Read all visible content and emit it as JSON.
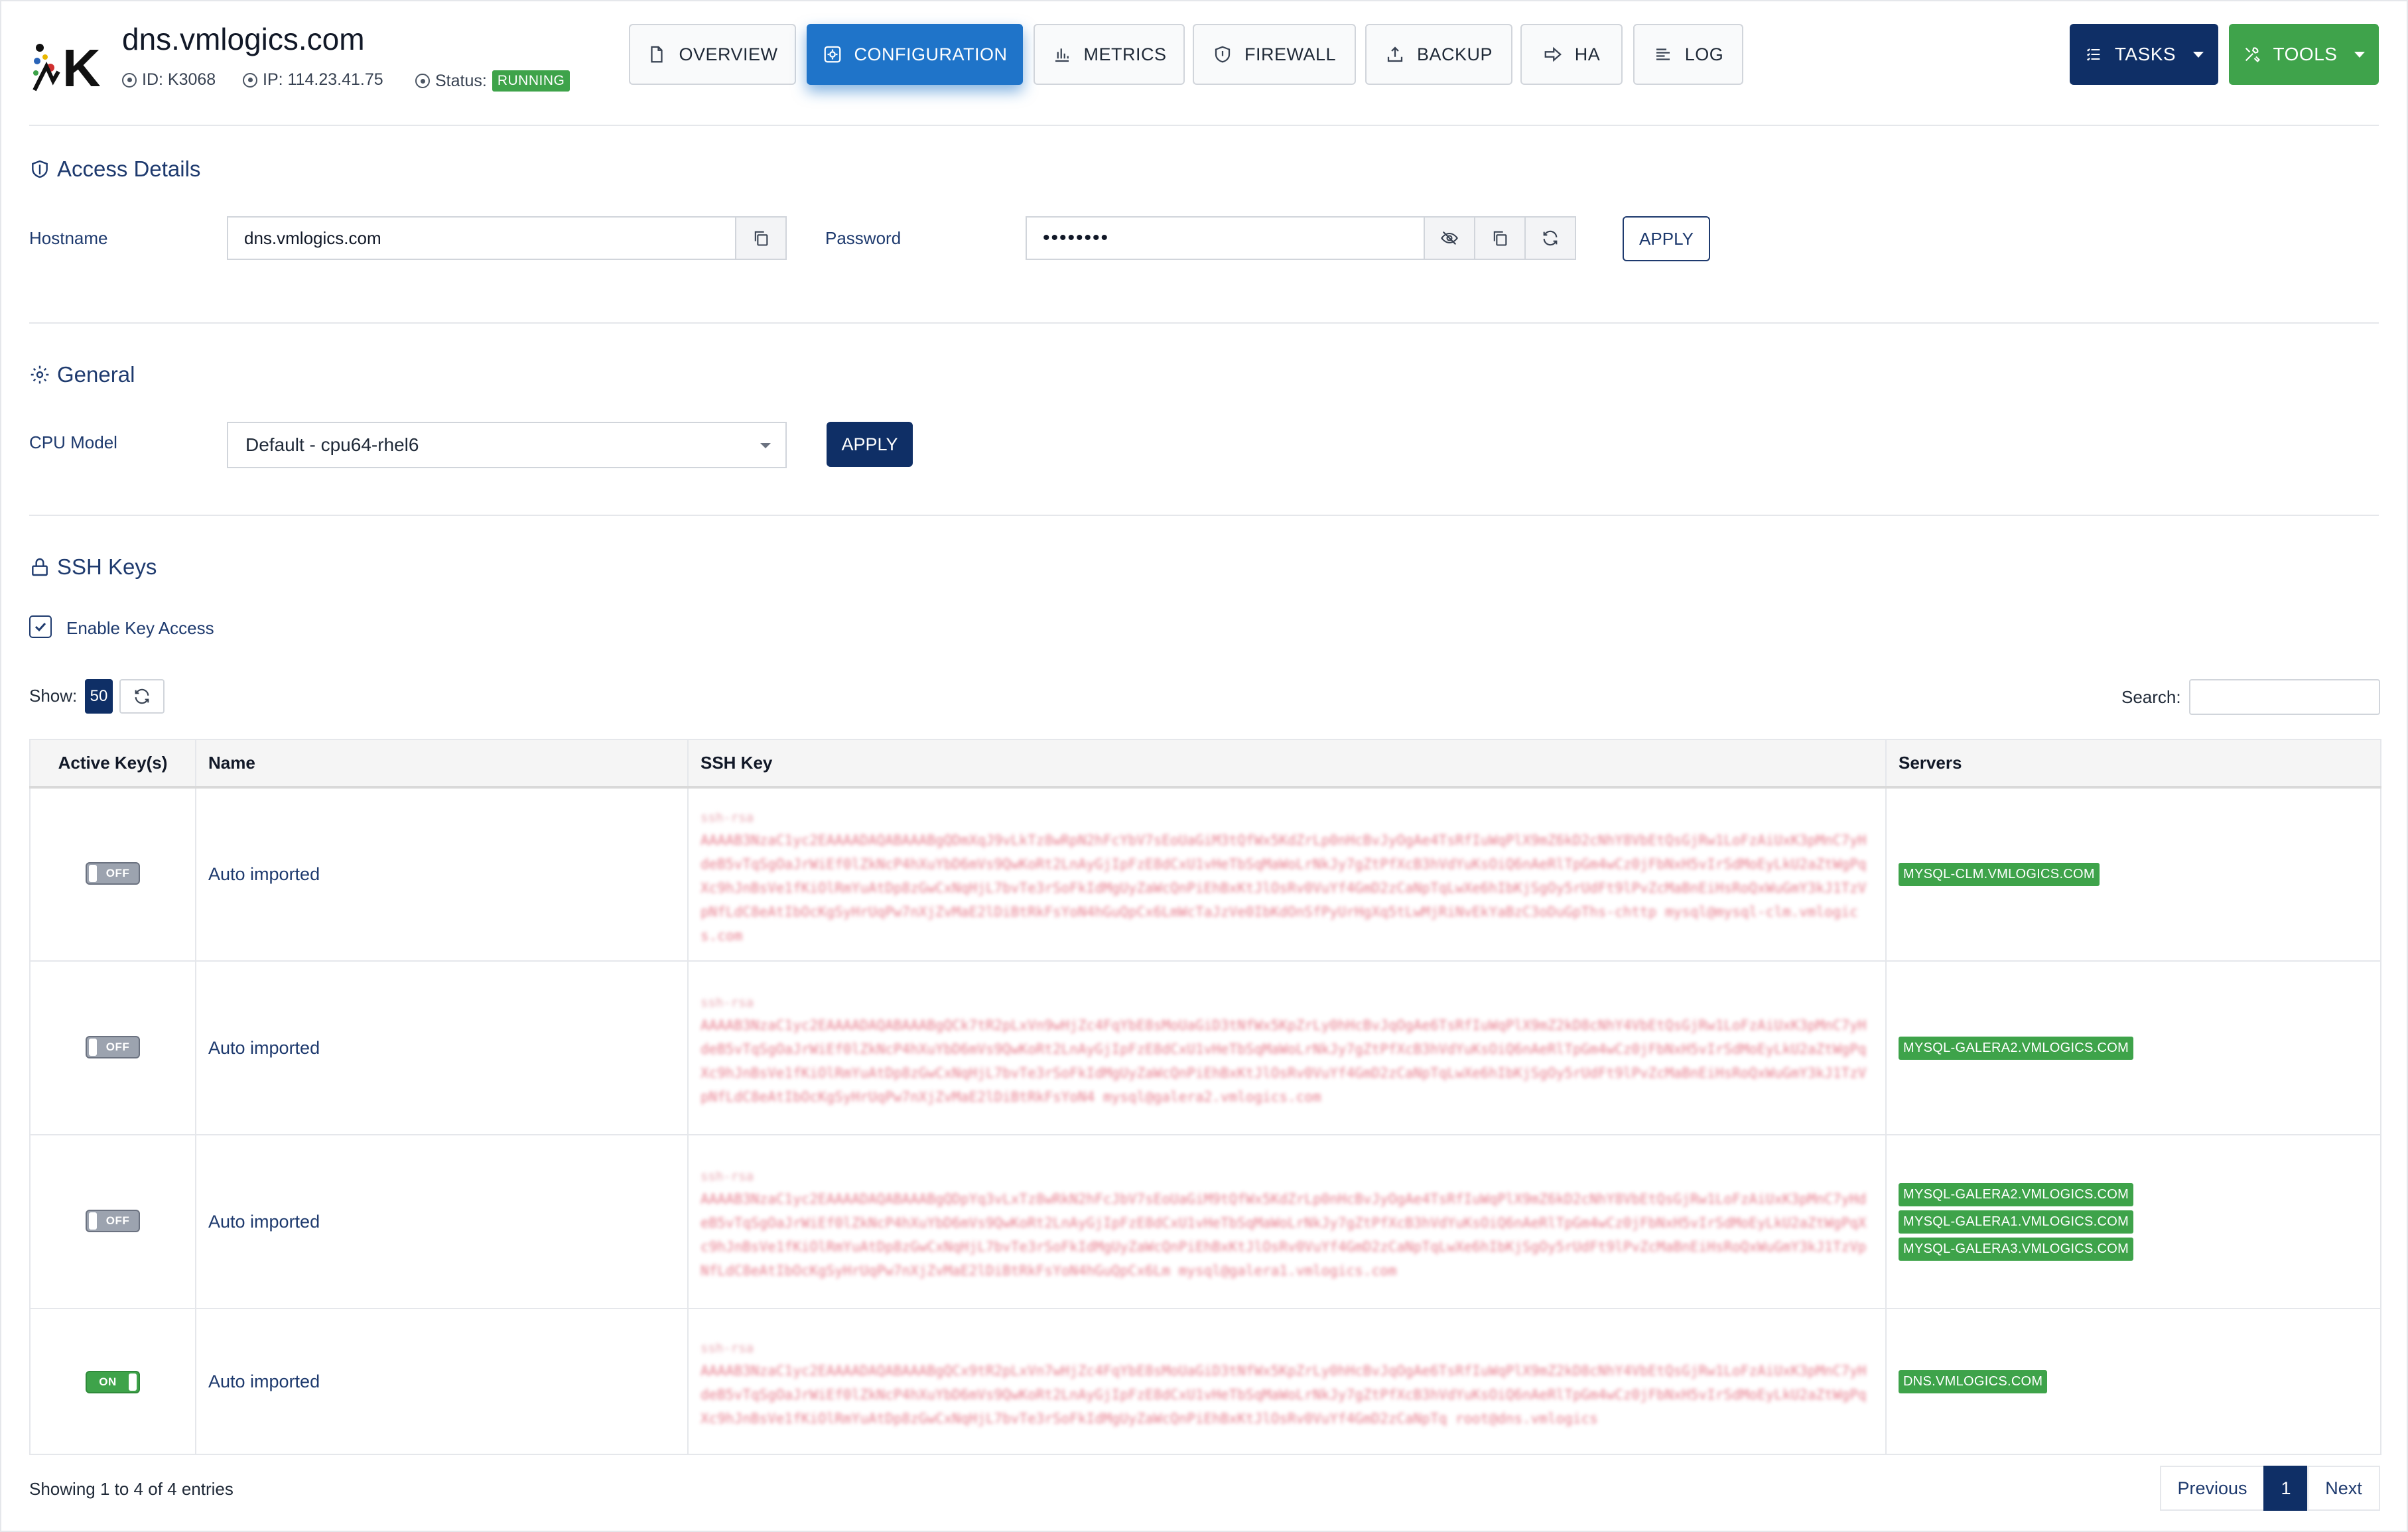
{
  "header": {
    "title": "dns.vmlogics.com",
    "id_label": "ID: K3068",
    "ip_label": "IP: 114.23.41.75",
    "status_label": "Status:",
    "status_value": "RUNNING",
    "status_color": "#3ea34a"
  },
  "nav_tabs": [
    {
      "label": "OVERVIEW",
      "icon": "file-icon"
    },
    {
      "label": "CONFIGURATION",
      "icon": "gear-icon",
      "active": true
    },
    {
      "label": "METRICS",
      "icon": "bar-chart-icon"
    },
    {
      "label": "FIREWALL",
      "icon": "shield-icon"
    },
    {
      "label": "BACKUP",
      "icon": "backup-icon"
    },
    {
      "label": "HA",
      "icon": "arrow-right-icon"
    },
    {
      "label": "LOG",
      "icon": "list-icon"
    }
  ],
  "actions": {
    "tasks_label": "TASKS",
    "tools_label": "TOOLS"
  },
  "access": {
    "title": "Access Details",
    "hostname_label": "Hostname",
    "hostname_value": "dns.vmlogics.com",
    "password_label": "Password",
    "password_value": "••••••••",
    "apply_label": "APPLY"
  },
  "general": {
    "title": "General",
    "cpu_label": "CPU Model",
    "cpu_value": "Default - cpu64-rhel6",
    "apply_label": "APPLY"
  },
  "ssh": {
    "title": "SSH Keys",
    "enable_label": "Enable Key Access",
    "enable_checked": true,
    "show_label": "Show:",
    "show_value": "50",
    "search_label": "Search:",
    "columns": [
      "Active Key(s)",
      "Name",
      "SSH Key",
      "Servers"
    ],
    "rows": [
      {
        "active": "OFF",
        "name": "Auto imported",
        "key_type": "ssh-rsa",
        "key": "AAAAB3NzaC1yc2EAAAADAQABAAABgQDmXqJ9vLkTz8wRpN2hFcYbV7sEoUaGiM3tQfWx5KdZrLp0nHcBvJyOgAe4TsRfIuWqPlX9mZ6kD2cNhY8VbEtQsGjRw1LoFzAiUxK3pMnC7yHdeB5vTqSgOaJrWiEf0lZkNcP4hXuYbD6mVs9QwKoRt2LnAyGjIpFzE8dCxU1vHeTbSqMaWoLrNkJy7gZtPfXcB3hVdYuKsOiQ6nAeRlTpGm4wCz0jFbNxH5vIrSdMoEyLkU2aZtWgPqXc9hJnBsVe1fKiOlRmYuAtDp8zGwCxNqHjL7bvTe3rSoFkIdMgUyZaWcQnPiEhBxKtJlOsRv0VuYf4GmD2zCaNpTqLwXe6hIbKjSgOy5rUdFt9lPvZcMaBnEiHsRoQxWuGmY3kJ1TzVpNfLdC8eAtIbOcKgSyHrUqPw7nXjZvMaE2lDiBtRkFsYoN4hGuQpCx6LmWcTaJzVe0IbKdOnSfPyUrHgXq5tLwMjRiNvEkYaBzC3oDuGpThs-chttp mysql@mysql-clm.vmlogics.com"
      },
      {
        "active": "OFF",
        "name": "Auto imported",
        "key_type": "ssh-rsa",
        "key": "AAAAB3NzaC1yc2EAAAADAQABAAABgQCk7tR2pLxVn9wHjZc4FqYbE8sMoUaGiD3tNfWx5KpZrLy0hHcBvJqOgAe6TsRfIuWqPlX9mZ2kD8cNhY4VbEtQsGjRw1LoFzAiUxK3pMnC7yHdeB5vTqSgOaJrWiEf0lZkNcP4hXuYbD6mVs9QwKoRt2LnAyGjIpFzE8dCxU1vHeTbSqMaWoLrNkJy7gZtPfXcB3hVdYuKsOiQ6nAeRlTpGm4wCz0jFbNxH5vIrSdMoEyLkU2aZtWgPqXc9hJnBsVe1fKiOlRmYuAtDp8zGwCxNqHjL7bvTe3rSoFkIdMgUyZaWcQnPiEhBxKtJlOsRv0VuYf4GmD2zCaNpTqLwXe6hIbKjSgOy5rUdFt9lPvZcMaBnEiHsRoQxWuGmY3kJ1TzVpNfLdC8eAtIbOcKgSyHrUqPw7nXjZvMaE2lDiBtRkFsYoN4 mysql@galera2.vmlogics.com"
      },
      {
        "active": "OFF",
        "name": "Auto imported",
        "key_type": "ssh-rsa",
        "key": "AAAAB3NzaC1yc2EAAAADAQABAAABgQDpYq3vLxTz8wRkN2hFcJbV7sEoUaGiM9tQfWx5KdZrLp0nHcBvJyOgAe4TsRfIuWqPlX9mZ6kD2cNhY8VbEtQsGjRw1LoFzAiUxK3pMnC7yHdeB5vTqSgOaJrWiEf0lZkNcP4hXuYbD6mVs9QwKoRt2LnAyGjIpFzE8dCxU1vHeTbSqMaWoLrNkJy7gZtPfXcB3hVdYuKsOiQ6nAeRlTpGm4wCz0jFbNxH5vIrSdMoEyLkU2aZtWgPqXc9hJnBsVe1fKiOlRmYuAtDp8zGwCxNqHjL7bvTe3rSoFkIdMgUyZaWcQnPiEhBxKtJlOsRv0VuYf4GmD2zCaNpTqLwXe6hIbKjSgOy5rUdFt9lPvZcMaBnEiHsRoQxWuGmY3kJ1TzVpNfLdC8eAtIbOcKgSyHrUqPw7nXjZvMaE2lDiBtRkFsYoN4hGuQpCx6Lm mysql@galera1.vmlogics.com"
      },
      {
        "active": "ON",
        "name": "Auto imported",
        "key_type": "ssh-rsa",
        "key": "AAAAB3NzaC1yc2EAAAADAQABAAABgQCx9tR2pLxVn7wHjZc4FqYbE8sMoUaGiD3tNfWx5KpZrLy0hHcBvJqOgAe6TsRfIuWqPlX9mZ2kD8cNhY4VbEtQsGjRw1LoFzAiUxK3pMnC7yHdeB5vTqSgOaJrWiEf0lZkNcP4hXuYbD6mVs9QwKoRt2LnAyGjIpFzE8dCxU1vHeTbSqMaWoLrNkJy7gZtPfXcB3hVdYuKsOiQ6nAeRlTpGm4wCz0jFbNxH5vIrSdMoEyLkU2aZtWgPqXc9hJnBsVe1fKiOlRmYuAtDp8zGwCxNqHjL7bvTe3rSoFkIdMgUyZaWcQnPiEhBxKtJlOsRv0VuYf4GmD2zCaNpTq root@dns.vmlogics"
      }
    ],
    "servers": [
      [
        "MYSQL-CLM.VMLOGICS.COM"
      ],
      [
        "MYSQL-GALERA2.VMLOGICS.COM"
      ],
      [
        "MYSQL-GALERA2.VMLOGICS.COM",
        "MYSQL-GALERA1.VMLOGICS.COM",
        "MYSQL-GALERA3.VMLOGICS.COM"
      ],
      [
        "DNS.VMLOGICS.COM"
      ]
    ]
  },
  "footer": {
    "showing": "Showing 1 to 4 of 4 entries",
    "prev_label": "Previous",
    "page": "1",
    "next_label": "Next"
  }
}
